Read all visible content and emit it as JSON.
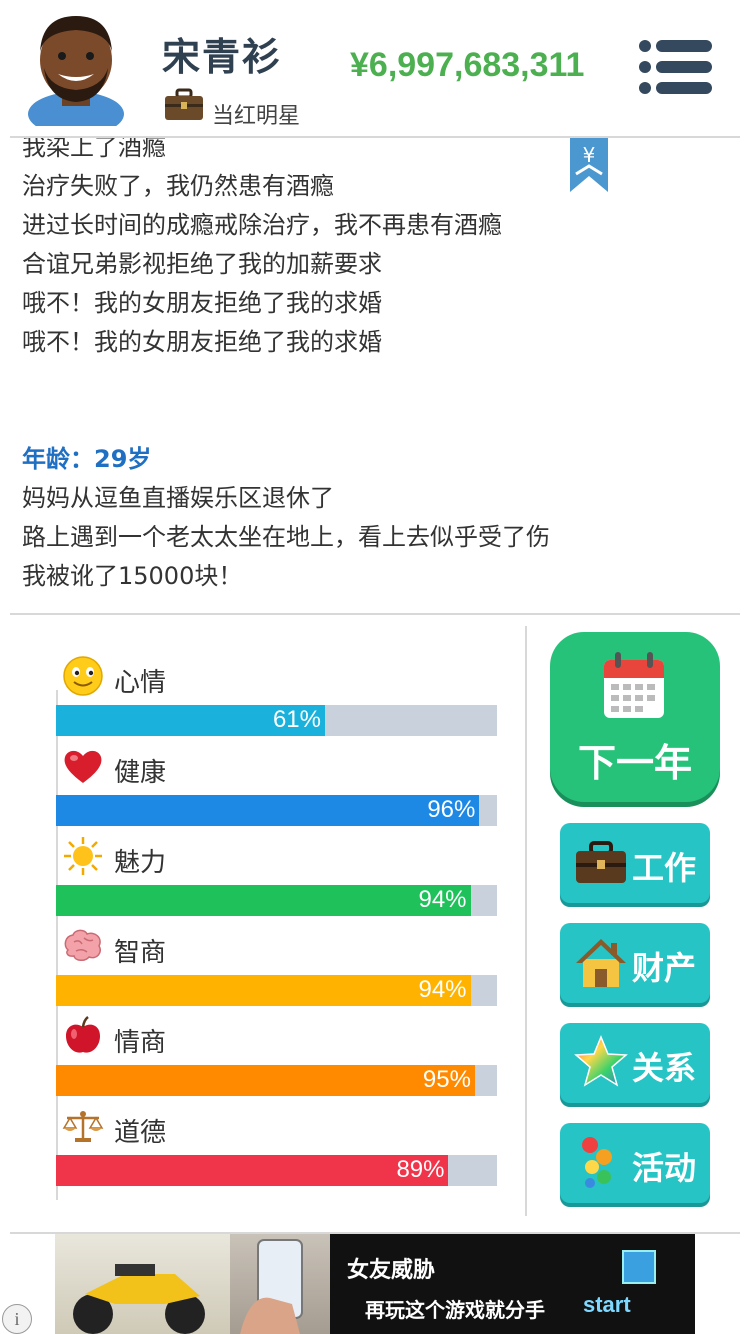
{
  "header": {
    "name": "宋青衫",
    "job_title": "当红明星",
    "money": "¥6,997,683,311"
  },
  "log": {
    "lines_before": [
      "我染上了酒瘾",
      "治疗失败了，我仍然患有酒瘾",
      "进过长时间的成瘾戒除治疗，我不再患有酒瘾",
      "合谊兄弟影视拒绝了我的加薪要求",
      "哦不！我的女朋友拒绝了我的求婚",
      "哦不！我的女朋友拒绝了我的求婚"
    ],
    "age_heading": "年龄：29岁",
    "lines_after": [
      "妈妈从逗鱼直播娱乐区退休了",
      "路上遇到一个老太太坐在地上，看上去似乎受了伤",
      "我被讹了15000块！"
    ],
    "bookmark_symbol": "¥"
  },
  "stats": [
    {
      "label": "心情",
      "pct": "61%",
      "value": 61,
      "color": "#1ab2dc",
      "icon": "smiley-icon"
    },
    {
      "label": "健康",
      "pct": "96%",
      "value": 96,
      "color": "#1e88e5",
      "icon": "heart-icon"
    },
    {
      "label": "魅力",
      "pct": "94%",
      "value": 94,
      "color": "#1ec15a",
      "icon": "sun-icon"
    },
    {
      "label": "智商",
      "pct": "94%",
      "value": 94,
      "color": "#ffb300",
      "icon": "brain-icon"
    },
    {
      "label": "情商",
      "pct": "95%",
      "value": 95,
      "color": "#ff8a00",
      "icon": "apple-icon"
    },
    {
      "label": "道德",
      "pct": "89%",
      "value": 89,
      "color": "#f0344a",
      "icon": "scales-icon"
    }
  ],
  "actions": {
    "next_year": "下一年",
    "work": "工作",
    "property": "财产",
    "relations": "关系",
    "activities": "活动"
  },
  "ad": {
    "line1": "女友威胁",
    "line2": "再玩这个游戏就分手",
    "cta": "start",
    "info": "i"
  }
}
